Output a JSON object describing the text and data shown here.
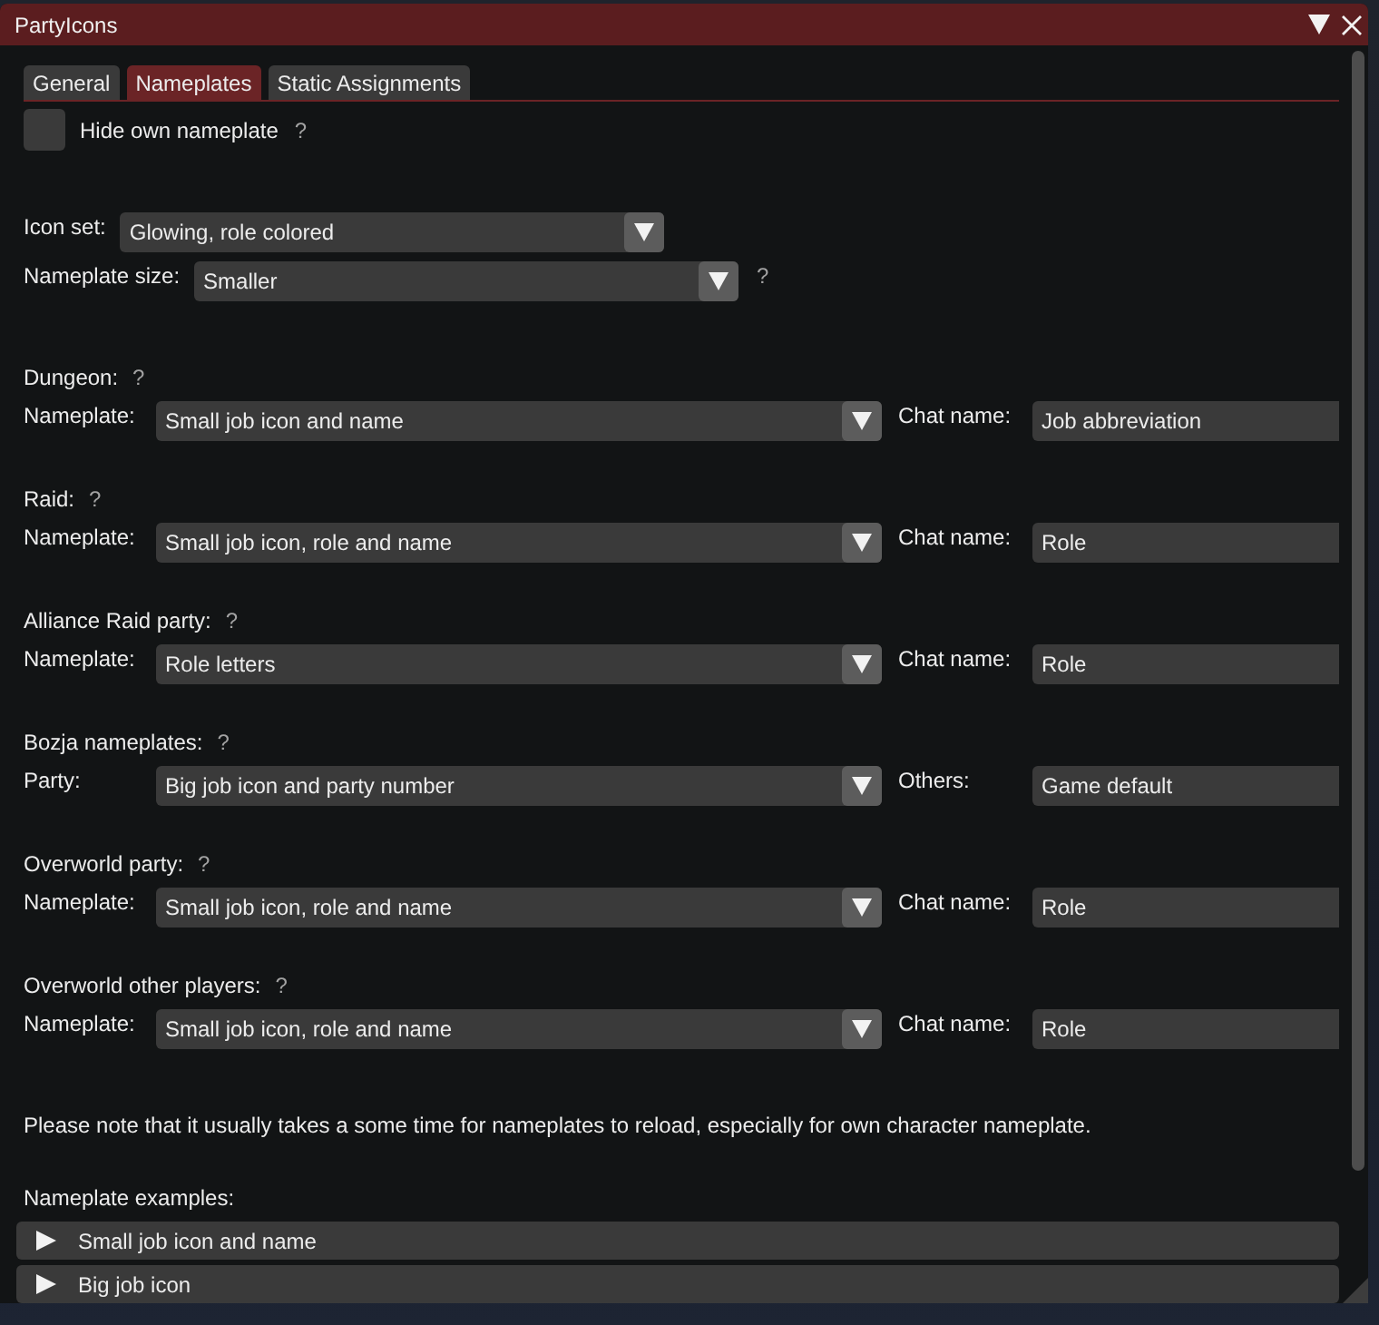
{
  "window": {
    "title": "PartyIcons"
  },
  "tabs": [
    {
      "label": "General",
      "selected": false
    },
    {
      "label": "Nameplates",
      "selected": true
    },
    {
      "label": "Static Assignments",
      "selected": false
    }
  ],
  "hide_own_nameplate": {
    "label": "Hide own nameplate",
    "checked": false,
    "help": "?"
  },
  "icon_set": {
    "label": "Icon set:",
    "value": "Glowing, role colored"
  },
  "nameplate_size": {
    "label": "Nameplate size:",
    "value": "Smaller",
    "help": "?"
  },
  "sections": [
    {
      "title": "Dungeon:",
      "help": "?",
      "primary": {
        "label": "Nameplate:",
        "value": "Small job icon and name"
      },
      "secondary": {
        "label": "Chat name:",
        "value": "Job abbreviation"
      }
    },
    {
      "title": "Raid:",
      "help": "?",
      "primary": {
        "label": "Nameplate:",
        "value": "Small job icon, role and name"
      },
      "secondary": {
        "label": "Chat name:",
        "value": "Role"
      }
    },
    {
      "title": "Alliance Raid party:",
      "help": "?",
      "primary": {
        "label": "Nameplate:",
        "value": "Role letters"
      },
      "secondary": {
        "label": "Chat name:",
        "value": "Role"
      }
    },
    {
      "title": "Bozja nameplates:",
      "help": "?",
      "primary": {
        "label": "Party:",
        "value": "Big job icon and party number"
      },
      "secondary": {
        "label": "Others:",
        "value": "Game default"
      }
    },
    {
      "title": "Overworld party:",
      "help": "?",
      "primary": {
        "label": "Nameplate:",
        "value": "Small job icon, role and name"
      },
      "secondary": {
        "label": "Chat name:",
        "value": "Role"
      }
    },
    {
      "title": "Overworld other players:",
      "help": "?",
      "primary": {
        "label": "Nameplate:",
        "value": "Small job icon, role and name"
      },
      "secondary": {
        "label": "Chat name:",
        "value": "Role"
      }
    }
  ],
  "note": "Please note that it usually takes a some time for nameplates to reload, especially for own character nameplate.",
  "examples": {
    "label": "Nameplate examples:",
    "headers": [
      {
        "label": "Small job icon and name",
        "expanded": false
      },
      {
        "label": "Big job icon",
        "expanded": false
      }
    ]
  }
}
